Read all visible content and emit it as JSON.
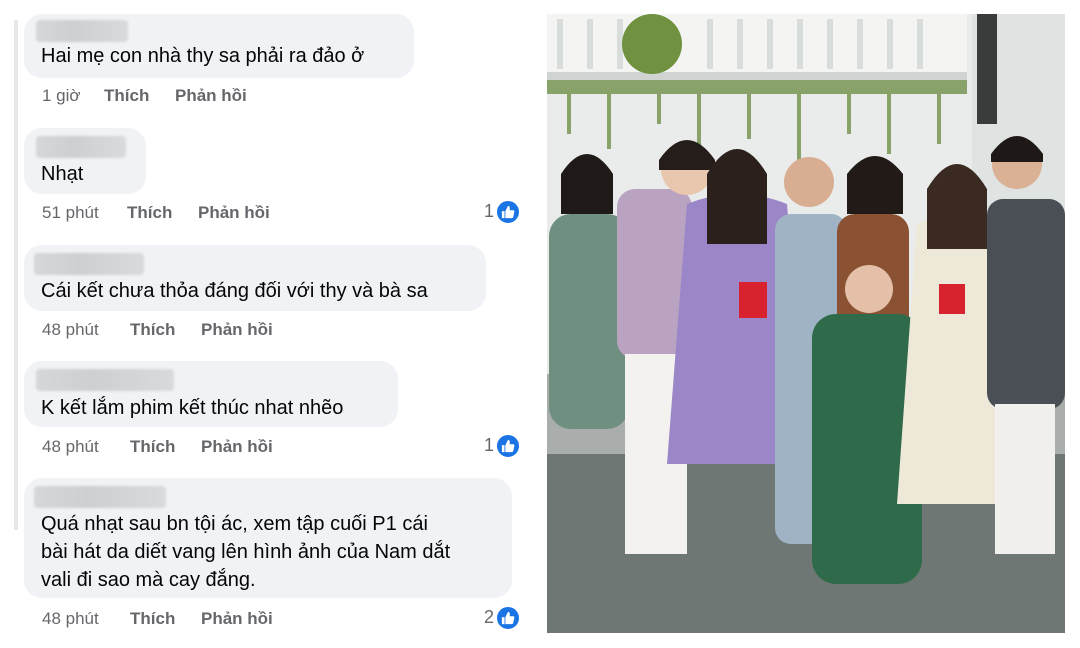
{
  "comments": [
    {
      "text": "Hai mẹ con nhà thy sa phải ra đảo ở",
      "time": "1 giờ",
      "like": "Thích",
      "reply": "Phản hồi",
      "reactions": ""
    },
    {
      "text": "Nhạt",
      "time": "51 phút",
      "like": "Thích",
      "reply": "Phản hồi",
      "reactions": "1"
    },
    {
      "text": "Cái kết chưa thỏa đáng đối với thy và bà sa",
      "time": "48 phút",
      "like": "Thích",
      "reply": "Phản hồi",
      "reactions": ""
    },
    {
      "text": "K kết lắm phim kết thúc nhat nhẽo",
      "time": "48 phút",
      "like": "Thích",
      "reply": "Phản hồi",
      "reactions": "1"
    },
    {
      "text_lines": [
        "Quá nhạt sau bn tội ác, xem tập cuối P1 cái",
        "bài hát da diết vang lên hình ảnh của Nam dắt",
        "vali đi sao mà cay đắng."
      ],
      "time": "48 phút",
      "like": "Thích",
      "reply": "Phản hồi",
      "reactions": "2"
    }
  ],
  "photo": {
    "description_icon": "family-group-photo",
    "colors": {
      "wall": "#eef0ee",
      "floor": "#6f7775",
      "purple": "#9b86c8",
      "green": "#2f6b4a"
    }
  },
  "icons": {
    "like": "thumbs-up-icon"
  },
  "colors": {
    "bubble": "#f0f2f5",
    "meta": "#65676b",
    "like_blue": "#1b74e4"
  }
}
